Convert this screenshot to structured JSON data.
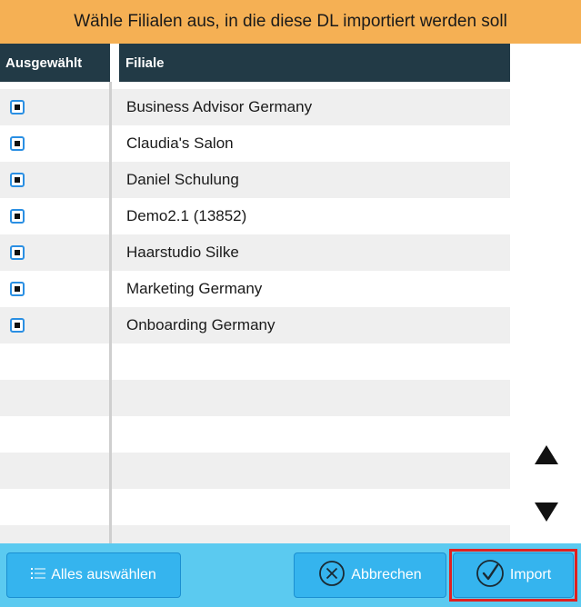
{
  "dialog": {
    "title": "Wähle Filialen aus, in die diese DL importiert werden soll"
  },
  "table": {
    "columns": [
      "Ausgewählt",
      "Filiale"
    ],
    "rows": [
      {
        "selected": true,
        "name": "Business Advisor Germany"
      },
      {
        "selected": true,
        "name": "Claudia's Salon"
      },
      {
        "selected": true,
        "name": "Daniel Schulung"
      },
      {
        "selected": true,
        "name": "Demo2.1 (13852)"
      },
      {
        "selected": true,
        "name": "Haarstudio Silke"
      },
      {
        "selected": true,
        "name": "Marketing Germany"
      },
      {
        "selected": true,
        "name": "Onboarding Germany"
      }
    ],
    "empty_rows": 6
  },
  "scroll": {
    "up_icon": "triangle-up-icon",
    "down_icon": "triangle-down-icon"
  },
  "footer": {
    "select_all_label": "Alles auswählen",
    "select_all_icon": "list-icon",
    "cancel_label": "Abbrechen",
    "cancel_icon": "circle-x-icon",
    "import_label": "Import",
    "import_icon": "circle-check-icon"
  },
  "colors": {
    "title_bar": "#f5b054",
    "header": "#223a46",
    "footer": "#5bcaf0",
    "button": "#35b4ee",
    "highlight": "#e02020"
  }
}
